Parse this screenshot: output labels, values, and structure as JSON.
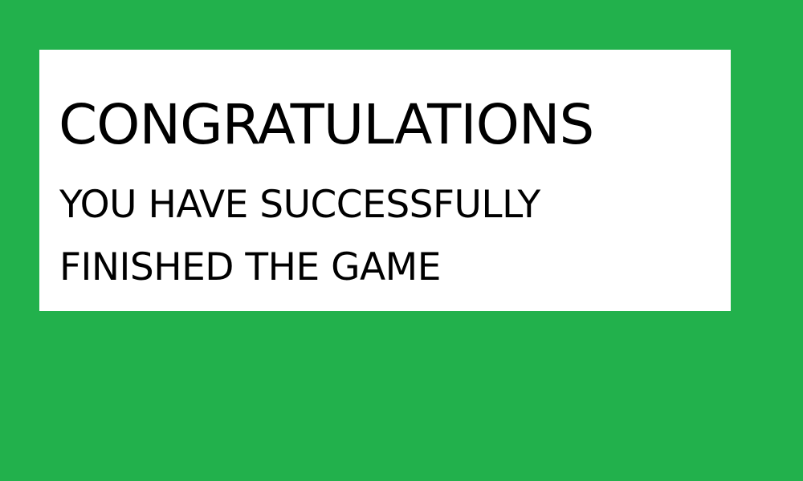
{
  "colors": {
    "background": "#22b14c",
    "panel": "#ffffff",
    "text": "#000000"
  },
  "message": {
    "title": "CONGRATULATIONS",
    "line1": "YOU HAVE SUCCESSFULLY",
    "line2": "FINISHED THE GAME"
  }
}
